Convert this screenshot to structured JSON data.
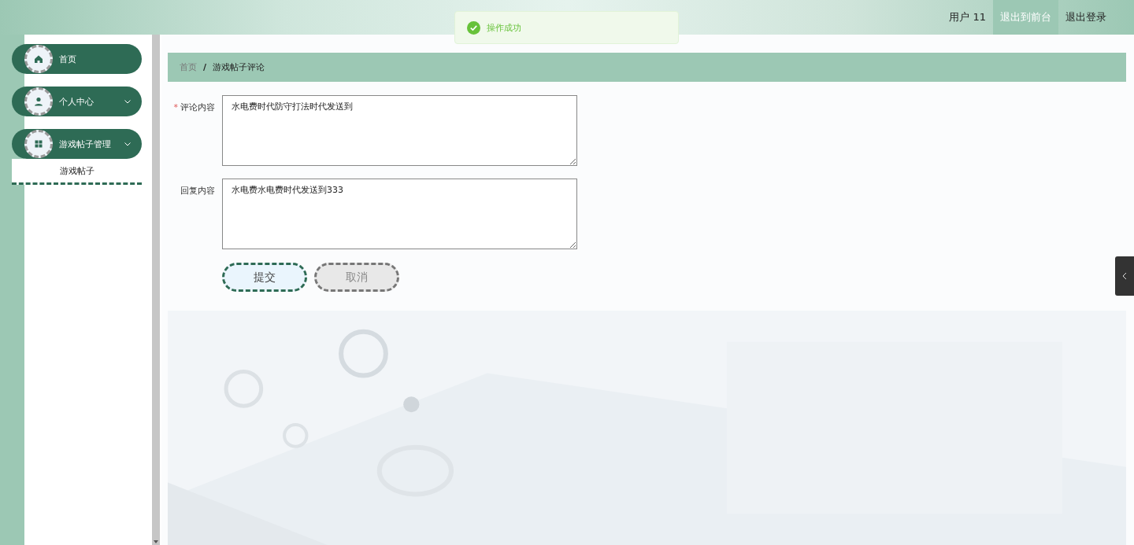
{
  "header": {
    "user": "用户 11",
    "actions": [
      {
        "label": "退出到前台",
        "selected": true
      },
      {
        "label": "退出登录",
        "selected": false
      }
    ]
  },
  "toast": {
    "message": "操作成功"
  },
  "sidebar": {
    "items": [
      {
        "label": "首页",
        "kind": "home",
        "expandable": false
      },
      {
        "label": "个人中心",
        "kind": "user",
        "expandable": true
      },
      {
        "label": "游戏帖子管理",
        "kind": "grid",
        "expandable": true,
        "children": [
          {
            "label": "游戏帖子",
            "selected": true
          }
        ]
      }
    ]
  },
  "breadcrumb": {
    "separator": "/",
    "items": [
      {
        "label": "首页",
        "current": false
      },
      {
        "label": "游戏帖子评论",
        "current": true
      }
    ]
  },
  "form": {
    "required_mark": "*",
    "fields": [
      {
        "label": "评论内容",
        "required": true,
        "value": "水电费时代防守打法时代发送到"
      },
      {
        "label": "回复内容",
        "required": false,
        "value": "水电费水电费时代发送到333"
      }
    ],
    "buttons": [
      {
        "label": "提交",
        "kind": "primary"
      },
      {
        "label": "取消",
        "kind": "cancel"
      }
    ]
  }
}
